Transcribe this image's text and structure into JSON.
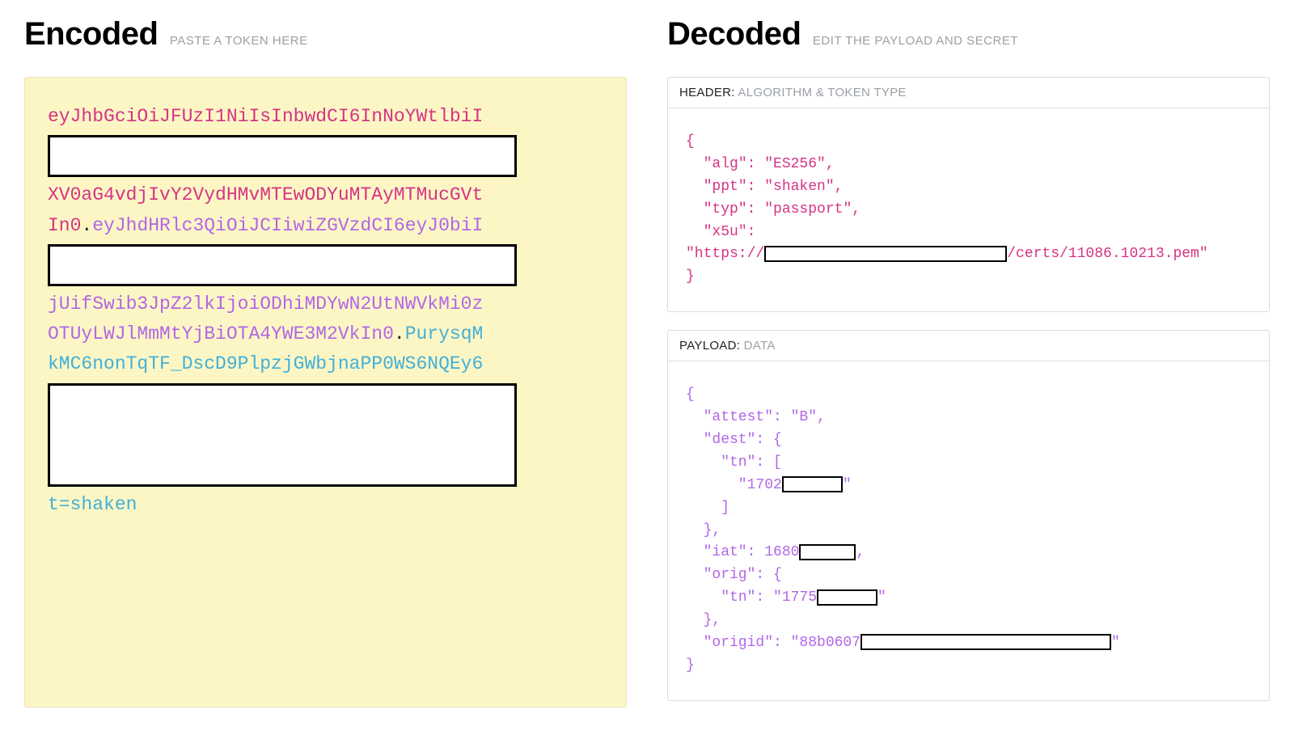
{
  "encoded": {
    "title": "Encoded",
    "subtitle": "PASTE A TOKEN HERE",
    "token": {
      "header_line1": "eyJhbGciOiJFUzI1NiIsInbwdCI6InNoYWtlbiI",
      "header_line2": "XV0aG4vdjIvY2VydHMvMTEwODYuMTAyMTMucGVt",
      "header_line3": "In0",
      "payload_line1": "eyJhdHRlc3QiOiJCIiwiZGVzdCI6eyJ0biI",
      "payload_line2": "jUifSwib3JpZ2lkIjoiODhiMDYwN2UtNWVkMi0z",
      "payload_line3": "OTUyLWJlMmMtYjBiOTA4YWE3M2VkIn0",
      "sig_line1": "PurysqM",
      "sig_line2": "kMC6nonTqTF_DscD9PlpzjGWbjnaPP0WS6NQEy6",
      "sig_line3": "t=shaken"
    }
  },
  "decoded": {
    "title": "Decoded",
    "subtitle": "EDIT THE PAYLOAD AND SECRET",
    "header_section": {
      "label": "HEADER:",
      "sub": "ALGORITHM & TOKEN TYPE",
      "open": "{",
      "alg_line": "  \"alg\": \"ES256\",",
      "ppt_line": "  \"ppt\": \"shaken\",",
      "typ_line": "  \"typ\": \"passport\",",
      "x5u_key": "  \"x5u\":",
      "x5u_prefix": "\"https://",
      "x5u_suffix": "/certs/11086.10213.pem\"",
      "close": "}"
    },
    "payload_section": {
      "label": "PAYLOAD:",
      "sub": "DATA",
      "open": "{",
      "attest": "  \"attest\": \"B\",",
      "dest_open": "  \"dest\": {",
      "tn_open": "    \"tn\": [",
      "tn_prefix": "      \"1702",
      "tn_suffix": "\"",
      "tn_close": "    ]",
      "dest_close": "  },",
      "iat_prefix": "  \"iat\": 1680",
      "iat_suffix": ",",
      "orig_open": "  \"orig\": {",
      "orig_tn_prefix": "    \"tn\": \"1775",
      "orig_tn_suffix": "\"",
      "orig_close": "  },",
      "origid_prefix": "  \"origid\": \"88b0607",
      "origid_suffix": "\"",
      "close": "}"
    }
  }
}
